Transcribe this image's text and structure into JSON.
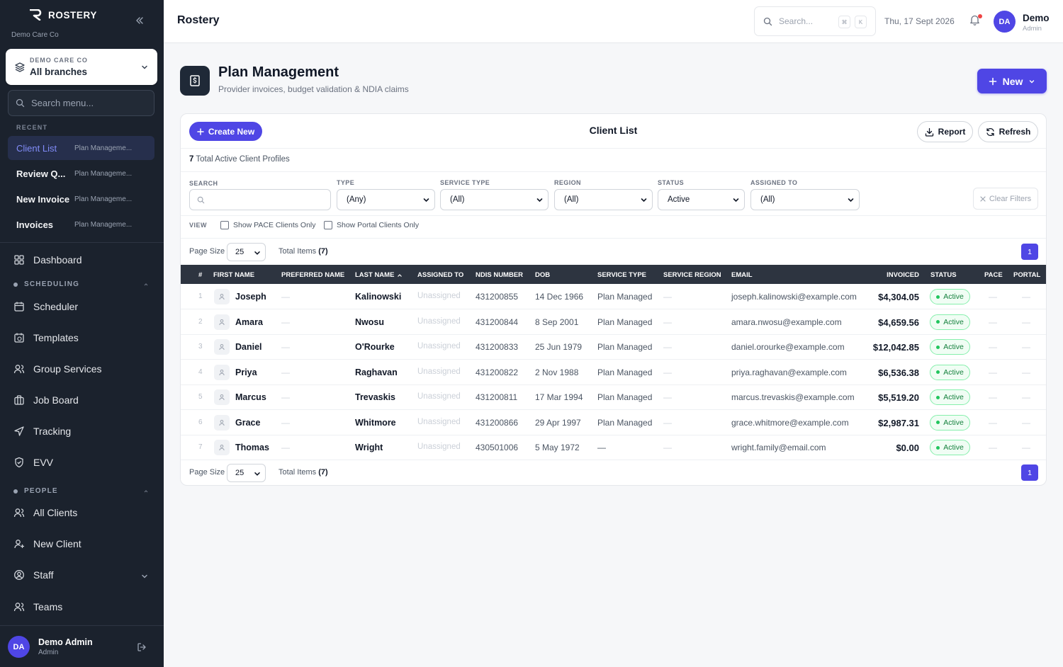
{
  "sidebar": {
    "brand": "ROSTERY",
    "company": "Demo Care Co",
    "branch_org": "DEMO CARE CO",
    "branch": "All branches",
    "search_placeholder": "Search menu...",
    "recent_label": "RECENT",
    "recent": [
      {
        "title": "Client List",
        "sub": "Plan Manageme..."
      },
      {
        "title": "Review Q...",
        "sub": "Plan Manageme..."
      },
      {
        "title": "New Invoice",
        "sub": "Plan Manageme..."
      },
      {
        "title": "Invoices",
        "sub": "Plan Manageme..."
      }
    ],
    "dashboard": "Dashboard",
    "scheduling_label": "SCHEDULING",
    "scheduling": [
      "Scheduler",
      "Templates",
      "Group Services",
      "Job Board",
      "Tracking",
      "EVV"
    ],
    "people_label": "PEOPLE",
    "people": [
      "All Clients",
      "New Client",
      "Staff",
      "Teams"
    ],
    "user": {
      "initials": "DA",
      "name": "Demo Admin",
      "role": "Admin"
    }
  },
  "topbar": {
    "title": "Rostery",
    "search_placeholder": "Search...",
    "kbd1": "⌘",
    "kbd2": "K",
    "date": "Thu, 17 Sept 2026",
    "user_initials": "DA",
    "user_name": "Demo",
    "user_role": "Admin"
  },
  "page": {
    "title": "Plan Management",
    "subtitle": "Provider invoices, budget validation & NDIA claims",
    "new_label": "New"
  },
  "card": {
    "create_label": "Create New",
    "title": "Client List",
    "report_label": "Report",
    "refresh_label": "Refresh",
    "total_count": "7",
    "total_text": "Total Active Client Profiles",
    "filters": {
      "search_label": "SEARCH",
      "type_label": "TYPE",
      "type_value": "(Any)",
      "service_label": "SERVICE TYPE",
      "service_value": "(All)",
      "region_label": "REGION",
      "region_value": "(All)",
      "status_label": "STATUS",
      "status_value": "Active",
      "assigned_label": "ASSIGNED TO",
      "assigned_value": "(All)",
      "clear_label": "Clear Filters"
    },
    "view_label": "VIEW",
    "pace_only": "Show PACE Clients Only",
    "portal_only": "Show Portal Clients Only",
    "page_size_label": "Page Size",
    "page_size": "25",
    "total_items_label": "Total Items",
    "total_items": "(7)",
    "page": "1"
  },
  "table": {
    "headers": [
      "#",
      "FIRST NAME",
      "PREFERRED NAME",
      "LAST NAME",
      "ASSIGNED TO",
      "NDIS NUMBER",
      "DOB",
      "SERVICE TYPE",
      "SERVICE REGION",
      "EMAIL",
      "INVOICED",
      "STATUS",
      "PACE",
      "PORTAL"
    ],
    "rows": [
      {
        "num": "1",
        "first": "Joseph",
        "pref": "—",
        "last": "Kalinowski",
        "assigned": "Unassigned",
        "ndis": "431200855",
        "dob": "14 Dec 1966",
        "service": "Plan Managed",
        "region": "—",
        "email": "joseph.kalinowski@example.com",
        "invoiced": "$4,304.05",
        "status": "Active",
        "pace": "—",
        "portal": "—"
      },
      {
        "num": "2",
        "first": "Amara",
        "pref": "—",
        "last": "Nwosu",
        "assigned": "Unassigned",
        "ndis": "431200844",
        "dob": "8 Sep 2001",
        "service": "Plan Managed",
        "region": "—",
        "email": "amara.nwosu@example.com",
        "invoiced": "$4,659.56",
        "status": "Active",
        "pace": "—",
        "portal": "—"
      },
      {
        "num": "3",
        "first": "Daniel",
        "pref": "—",
        "last": "O'Rourke",
        "assigned": "Unassigned",
        "ndis": "431200833",
        "dob": "25 Jun 1979",
        "service": "Plan Managed",
        "region": "—",
        "email": "daniel.orourke@example.com",
        "invoiced": "$12,042.85",
        "status": "Active",
        "pace": "—",
        "portal": "—"
      },
      {
        "num": "4",
        "first": "Priya",
        "pref": "—",
        "last": "Raghavan",
        "assigned": "Unassigned",
        "ndis": "431200822",
        "dob": "2 Nov 1988",
        "service": "Plan Managed",
        "region": "—",
        "email": "priya.raghavan@example.com",
        "invoiced": "$6,536.38",
        "status": "Active",
        "pace": "—",
        "portal": "—"
      },
      {
        "num": "5",
        "first": "Marcus",
        "pref": "—",
        "last": "Trevaskis",
        "assigned": "Unassigned",
        "ndis": "431200811",
        "dob": "17 Mar 1994",
        "service": "Plan Managed",
        "region": "—",
        "email": "marcus.trevaskis@example.com",
        "invoiced": "$5,519.20",
        "status": "Active",
        "pace": "—",
        "portal": "—"
      },
      {
        "num": "6",
        "first": "Grace",
        "pref": "—",
        "last": "Whitmore",
        "assigned": "Unassigned",
        "ndis": "431200866",
        "dob": "29 Apr 1997",
        "service": "Plan Managed",
        "region": "—",
        "email": "grace.whitmore@example.com",
        "invoiced": "$2,987.31",
        "status": "Active",
        "pace": "—",
        "portal": "—"
      },
      {
        "num": "7",
        "first": "Thomas",
        "pref": "—",
        "last": "Wright",
        "assigned": "Unassigned",
        "ndis": "430501006",
        "dob": "5 May 1972",
        "service": "—",
        "region": "—",
        "email": "wright.family@email.com",
        "invoiced": "$0.00",
        "status": "Active",
        "pace": "—",
        "portal": "—"
      }
    ]
  },
  "colors": {
    "accent": "#4f46e5",
    "sidebar": "#1b222d",
    "active_green": "#15803d"
  }
}
